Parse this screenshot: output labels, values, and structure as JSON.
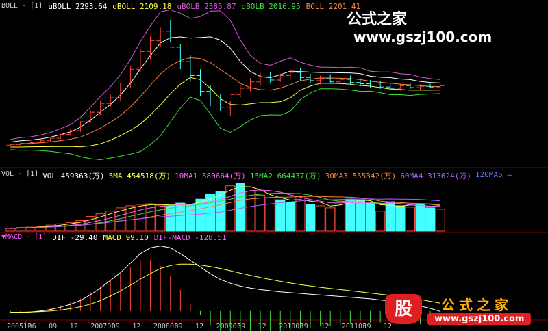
{
  "watermark": {
    "top_name": "公式之家",
    "top_url": "www.gszj100.com",
    "bottom_name": "公式之家",
    "bottom_url": "www.gszj100.com",
    "bottom_logo": "股"
  },
  "colors": {
    "up": "#ff4a3a",
    "down": "#44ffff",
    "grid": "#7a0000",
    "mid": "#ffffff",
    "upper": "#d45cd4",
    "lower": "#40e040",
    "boll": "#ff8040",
    "yellow": "#ffff40"
  },
  "panels": {
    "boll": {
      "tag": "BOLL - [1]",
      "legend": [
        {
          "text": "uBOLL 2293.64",
          "color": "#ffffff"
        },
        {
          "text": "dBOLL 2109.18",
          "color": "#ffff40"
        },
        {
          "text": "uBOLB 2385.87",
          "color": "#d45cd4"
        },
        {
          "text": "dBOLB 2016.95",
          "color": "#40e040"
        },
        {
          "text": "BOLL 2201.41",
          "color": "#ff8040"
        }
      ]
    },
    "vol": {
      "tag": "VOL - [1]",
      "legend": [
        {
          "text": "VOL 459363(万)",
          "color": "#ffffff"
        },
        {
          "text": "5MA 454518(万)",
          "color": "#ffff40"
        },
        {
          "text": "10MA1 580664(万)",
          "color": "#ff60ff"
        },
        {
          "text": "15MA2 664437(万)",
          "color": "#40e040"
        },
        {
          "text": "30MA3 555342(万)",
          "color": "#ff8040"
        },
        {
          "text": "60MA4 313624(万)",
          "color": "#b060ff"
        },
        {
          "text": "120MA5 —",
          "color": "#6a7cff"
        }
      ]
    },
    "macd": {
      "tag": "▼MACD - [1]",
      "legend": [
        {
          "text": "DIF -29.40",
          "color": "#ffffff"
        },
        {
          "text": "MACD 99.10",
          "color": "#ffff40"
        },
        {
          "text": "DIF-MACD -128.51",
          "color": "#ff60ff"
        }
      ]
    }
  },
  "chart_data": {
    "type": "candlestick",
    "x_ticks": [
      "200512",
      "06",
      "09",
      "12",
      "200703",
      "09",
      "12",
      "200803",
      "09",
      "12",
      "200903",
      "09",
      "12",
      "201003",
      "09",
      "12",
      "201103",
      "09",
      "12"
    ],
    "ohlc": [
      [
        1100,
        1120,
        1090,
        1110
      ],
      [
        1110,
        1140,
        1095,
        1130
      ],
      [
        1130,
        1150,
        1110,
        1140
      ],
      [
        1140,
        1180,
        1130,
        1170
      ],
      [
        1170,
        1220,
        1160,
        1210
      ],
      [
        1210,
        1280,
        1200,
        1270
      ],
      [
        1270,
        1350,
        1250,
        1330
      ],
      [
        1330,
        1480,
        1310,
        1470
      ],
      [
        1470,
        1650,
        1450,
        1620
      ],
      [
        1620,
        1800,
        1580,
        1760
      ],
      [
        1760,
        1900,
        1700,
        1850
      ],
      [
        1850,
        2080,
        1800,
        2050
      ],
      [
        2050,
        2350,
        2000,
        2300
      ],
      [
        2300,
        2620,
        2250,
        2580
      ],
      [
        2580,
        2820,
        2450,
        2750
      ],
      [
        2750,
        2960,
        2650,
        2900
      ],
      [
        2900,
        3080,
        2720,
        2650
      ],
      [
        2650,
        2700,
        2300,
        2420
      ],
      [
        2420,
        2520,
        2100,
        2200
      ],
      [
        2200,
        2300,
        1880,
        1950
      ],
      [
        1950,
        2050,
        1720,
        1800
      ],
      [
        1800,
        1900,
        1640,
        1700
      ],
      [
        1700,
        1800,
        1560,
        1900
      ],
      [
        1900,
        2040,
        1850,
        2000
      ],
      [
        2000,
        2160,
        1950,
        2100
      ],
      [
        2100,
        2240,
        2050,
        2180
      ],
      [
        2180,
        2260,
        2080,
        2130
      ],
      [
        2130,
        2230,
        2100,
        2200
      ],
      [
        2200,
        2300,
        2150,
        2250
      ],
      [
        2250,
        2320,
        2120,
        2170
      ],
      [
        2170,
        2230,
        2080,
        2120
      ],
      [
        2120,
        2200,
        2060,
        2150
      ],
      [
        2150,
        2220,
        2080,
        2100
      ],
      [
        2100,
        2180,
        2050,
        2140
      ],
      [
        2140,
        2200,
        2060,
        2090
      ],
      [
        2090,
        2150,
        2030,
        2070
      ],
      [
        2070,
        2130,
        2010,
        2050
      ],
      [
        2050,
        2110,
        1990,
        2020
      ],
      [
        2020,
        2080,
        1980,
        2000
      ],
      [
        2000,
        2060,
        1960,
        2040
      ],
      [
        2040,
        2080,
        1990,
        2010
      ],
      [
        2010,
        2060,
        1970,
        2030
      ],
      [
        2030,
        2070,
        2000,
        2020
      ],
      [
        2020,
        2050,
        1990,
        2040
      ]
    ],
    "boll_ylim": [
      800,
      3200
    ],
    "volume": [
      40,
      55,
      60,
      70,
      90,
      110,
      130,
      160,
      220,
      260,
      300,
      350,
      380,
      400,
      410,
      390,
      380,
      420,
      400,
      480,
      560,
      600,
      680,
      720,
      600,
      540,
      500,
      470,
      430,
      520,
      400,
      380,
      350,
      450,
      480,
      470,
      420,
      300,
      440,
      380,
      360,
      410,
      350,
      330
    ],
    "volume_up": [
      true,
      true,
      true,
      true,
      true,
      true,
      true,
      true,
      true,
      true,
      true,
      true,
      true,
      true,
      true,
      true,
      false,
      false,
      false,
      false,
      false,
      false,
      true,
      false,
      true,
      true,
      true,
      false,
      false,
      true,
      false,
      true,
      true,
      true,
      false,
      false,
      false,
      true,
      false,
      false,
      true,
      false,
      false,
      true
    ],
    "vol_ylim": [
      0,
      780
    ],
    "macd_dif": [
      -10,
      -8,
      -5,
      0,
      8,
      20,
      35,
      55,
      85,
      120,
      160,
      200,
      250,
      300,
      330,
      340,
      330,
      300,
      265,
      230,
      195,
      165,
      145,
      130,
      120,
      112,
      106,
      100,
      96,
      92,
      88,
      84,
      80,
      76,
      72,
      68,
      64,
      58,
      52,
      44,
      36,
      26,
      14,
      -2
    ],
    "macd_dea": [
      -6,
      -6,
      -5,
      -3,
      0,
      5,
      12,
      22,
      36,
      55,
      78,
      105,
      135,
      167,
      196,
      222,
      238,
      245,
      245,
      240,
      232,
      222,
      210,
      198,
      186,
      175,
      165,
      155,
      146,
      138,
      131,
      124,
      118,
      112,
      106,
      100,
      94,
      88,
      82,
      75,
      68,
      60,
      51,
      41
    ],
    "macd_ylim": [
      -40,
      360
    ]
  }
}
